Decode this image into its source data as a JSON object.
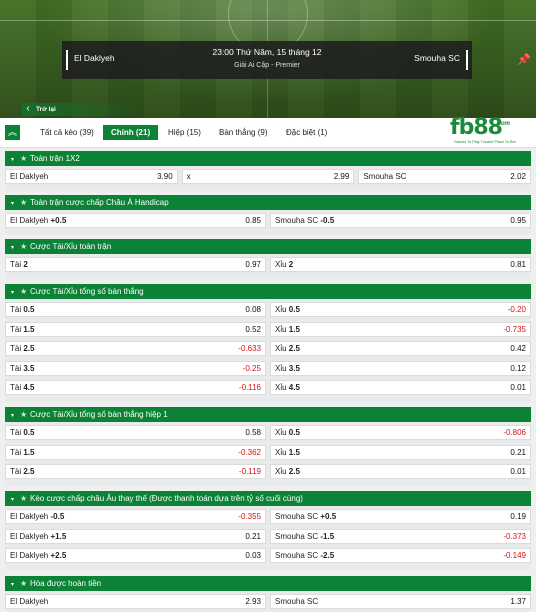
{
  "match": {
    "home": "El Daklyeh",
    "away": "Smouha SC",
    "datetime": "23:00 Thứ Năm, 15 tháng 12",
    "league": "Giải Ai Cập - Premier"
  },
  "back_label": "Trở lại",
  "tabs": [
    {
      "label": "Tất cả kèo (39)",
      "active": false
    },
    {
      "label": "Chính (21)",
      "active": true
    },
    {
      "label": "Hiệp (15)",
      "active": false
    },
    {
      "label": "Bàn thắng (9)",
      "active": false
    },
    {
      "label": "Đặc biệt (1)",
      "active": false
    }
  ],
  "logo": {
    "text_a": "fb",
    "text_b": "88",
    "domain": ".com",
    "tagline": "Games To Play   Trusted Place To Bet"
  },
  "colors": {
    "accent": "#0c8236",
    "negative": "#d21515"
  },
  "markets": [
    {
      "title": "Toàn trận 1X2",
      "rows": [
        [
          {
            "name": "El Daklyeh",
            "line": "",
            "odd": "3.90"
          },
          {
            "name": "x",
            "line": "",
            "odd": "2.99"
          },
          {
            "name": "Smouha SC",
            "line": "",
            "odd": "2.02"
          }
        ]
      ]
    },
    {
      "title": "Toàn trận cược chấp Châu Á Handicap",
      "rows": [
        [
          {
            "name": "El Daklyeh",
            "line": "+0.5",
            "odd": "0.85"
          },
          {
            "name": "Smouha SC",
            "line": "-0.5",
            "odd": "0.95"
          }
        ]
      ]
    },
    {
      "title": "Cược Tài/Xỉu toàn trận",
      "rows": [
        [
          {
            "name": "Tài",
            "line": "2",
            "odd": "0.97"
          },
          {
            "name": "Xỉu",
            "line": "2",
            "odd": "0.81"
          }
        ]
      ]
    },
    {
      "title": "Cược Tài/Xỉu tổng số bàn thắng",
      "rows": [
        [
          {
            "name": "Tài",
            "line": "0.5",
            "odd": "0.08"
          },
          {
            "name": "Xỉu",
            "line": "0.5",
            "odd": "-0.20"
          }
        ],
        [
          {
            "name": "Tài",
            "line": "1.5",
            "odd": "0.52"
          },
          {
            "name": "Xỉu",
            "line": "1.5",
            "odd": "-0.735"
          }
        ],
        [
          {
            "name": "Tài",
            "line": "2.5",
            "odd": "-0.633"
          },
          {
            "name": "Xỉu",
            "line": "2.5",
            "odd": "0.42"
          }
        ],
        [
          {
            "name": "Tài",
            "line": "3.5",
            "odd": "-0.25"
          },
          {
            "name": "Xỉu",
            "line": "3.5",
            "odd": "0.12"
          }
        ],
        [
          {
            "name": "Tài",
            "line": "4.5",
            "odd": "-0.116"
          },
          {
            "name": "Xỉu",
            "line": "4.5",
            "odd": "0.01"
          }
        ]
      ]
    },
    {
      "title": "Cược Tài/Xỉu tổng số bàn thắng hiệp 1",
      "rows": [
        [
          {
            "name": "Tài",
            "line": "0.5",
            "odd": "0.58"
          },
          {
            "name": "Xỉu",
            "line": "0.5",
            "odd": "-0.806"
          }
        ],
        [
          {
            "name": "Tài",
            "line": "1.5",
            "odd": "-0.362"
          },
          {
            "name": "Xỉu",
            "line": "1.5",
            "odd": "0.21"
          }
        ],
        [
          {
            "name": "Tài",
            "line": "2.5",
            "odd": "-0.119"
          },
          {
            "name": "Xỉu",
            "line": "2.5",
            "odd": "0.01"
          }
        ]
      ]
    },
    {
      "title": "Kèo cược chấp châu Âu thay thế (Được thanh toán dựa trên tỷ số cuối cùng)",
      "rows": [
        [
          {
            "name": "El Daklyeh",
            "line": "-0.5",
            "odd": "-0.355"
          },
          {
            "name": "Smouha SC",
            "line": "+0.5",
            "odd": "0.19"
          }
        ],
        [
          {
            "name": "El Daklyeh",
            "line": "+1.5",
            "odd": "0.21"
          },
          {
            "name": "Smouha SC",
            "line": "-1.5",
            "odd": "-0.373"
          }
        ],
        [
          {
            "name": "El Daklyeh",
            "line": "+2.5",
            "odd": "0.03"
          },
          {
            "name": "Smouha SC",
            "line": "-2.5",
            "odd": "-0.149"
          }
        ]
      ]
    },
    {
      "title": "Hòa được hoàn tiền",
      "rows": [
        [
          {
            "name": "El Daklyeh",
            "line": "",
            "odd": "2.93"
          },
          {
            "name": "Smouha SC",
            "line": "",
            "odd": "1.37"
          }
        ]
      ]
    }
  ]
}
